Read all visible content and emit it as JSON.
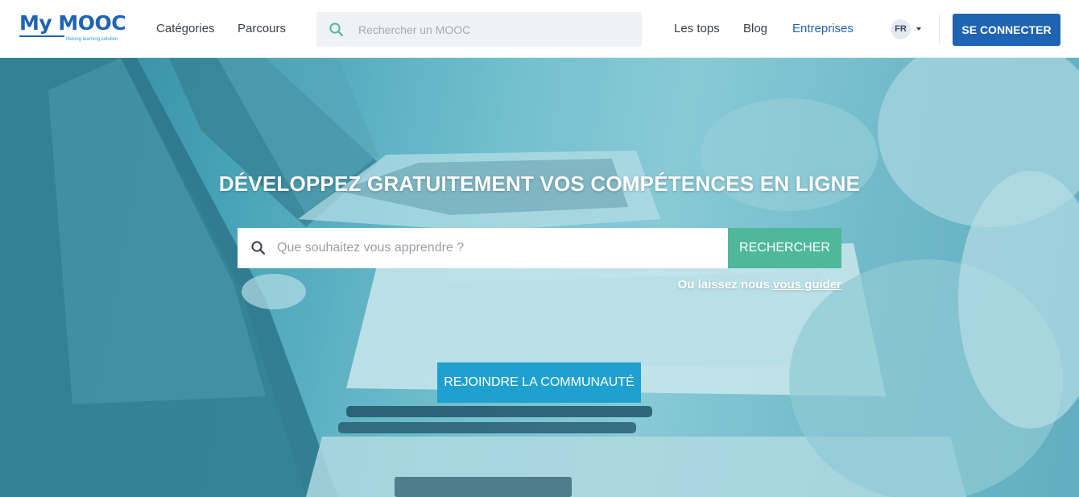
{
  "header": {
    "logo_text": "My MOOC",
    "logo_tagline": "lifelong learning solution",
    "nav_left": [
      {
        "label": "Catégories"
      },
      {
        "label": "Parcours"
      }
    ],
    "search": {
      "placeholder": "Rechercher un MOOC",
      "value": "",
      "icon": "search-icon"
    },
    "nav_right": [
      {
        "label": "Les tops"
      },
      {
        "label": "Blog"
      },
      {
        "label": "Entreprises"
      }
    ],
    "language": {
      "current": "FR",
      "icon": "caret-down-icon"
    },
    "connect_label": "SE CONNECTER"
  },
  "hero": {
    "title": "DÉVELOPPEZ GRATUITEMENT VOS COMPÉTENCES EN LIGNE",
    "search": {
      "placeholder": "Que souhaitez vous apprendre ?",
      "value": "",
      "button_label": "RECHERCHER",
      "icon": "search-icon"
    },
    "guide_prefix": "Ou laissez nous",
    "guide_link": "vous guider",
    "community_label": "REJOINDRE LA COMMUNAUTÉ"
  },
  "colors": {
    "brand_blue": "#1f63b3",
    "search_green": "#4fb89a",
    "community_blue": "#1ea1cf",
    "hero_tint": "#6fbfcd"
  }
}
